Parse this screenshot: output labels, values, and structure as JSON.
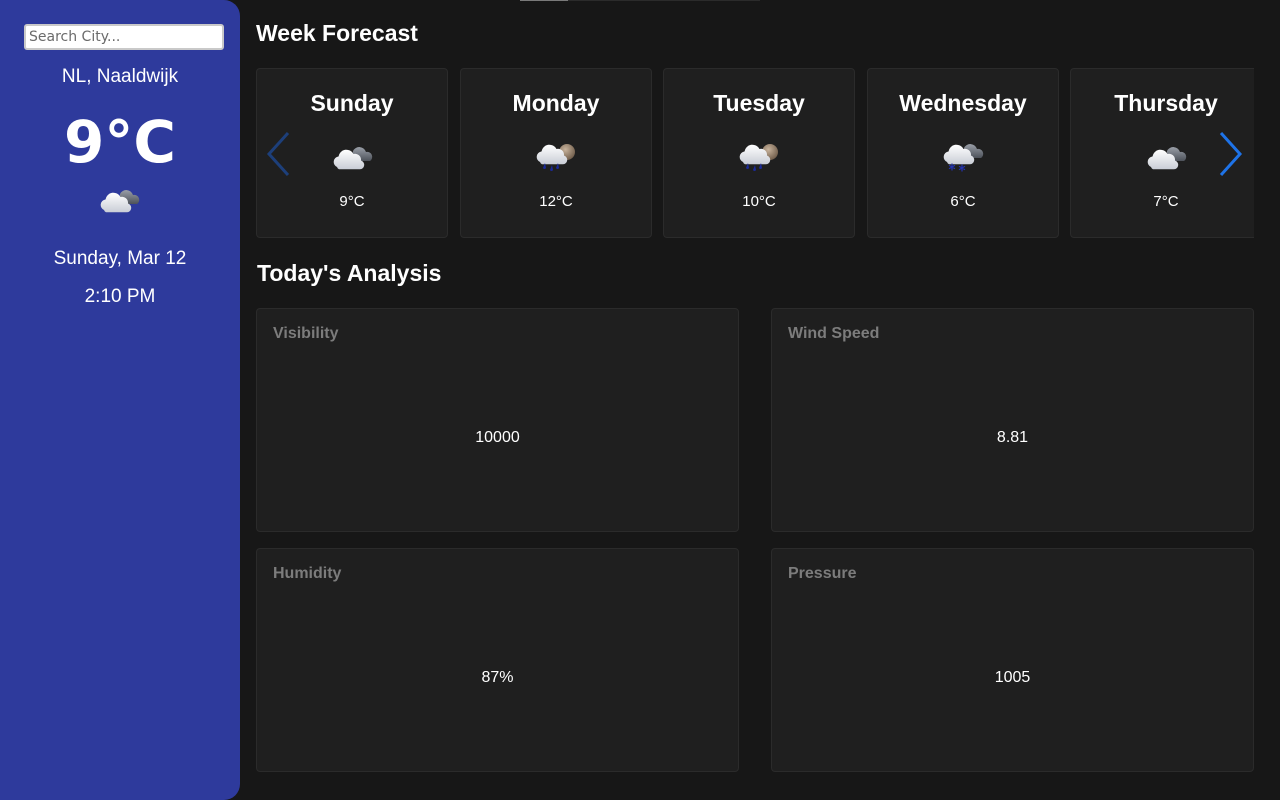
{
  "sidebar": {
    "search_placeholder": "Search City...",
    "location": "NL, Naaldwijk",
    "temperature": "9°C",
    "icon": "cloudy-icon",
    "date": "Sunday, Mar 12",
    "time": "2:10 PM"
  },
  "week": {
    "title": "Week Forecast",
    "days": [
      {
        "name": "Sunday",
        "temp": "9°C",
        "icon": "cloudy-icon"
      },
      {
        "name": "Monday",
        "temp": "12°C",
        "icon": "rain-icon"
      },
      {
        "name": "Tuesday",
        "temp": "10°C",
        "icon": "rain-icon"
      },
      {
        "name": "Wednesday",
        "temp": "6°C",
        "icon": "snow-icon"
      },
      {
        "name": "Thursday",
        "temp": "7°C",
        "icon": "cloudy-icon"
      }
    ]
  },
  "analysis": {
    "title": "Today's Analysis",
    "metrics": [
      {
        "label": "Visibility",
        "value": "10000"
      },
      {
        "label": "Wind Speed",
        "value": "8.81"
      },
      {
        "label": "Humidity",
        "value": "87%"
      },
      {
        "label": "Pressure",
        "value": "1005"
      }
    ]
  },
  "colors": {
    "sidebar_bg": "#2e3a9c",
    "page_bg": "#171717",
    "card_bg": "#1f1f1f",
    "arrow_active": "#1e73e8",
    "arrow_inactive": "#1d3f7a"
  }
}
